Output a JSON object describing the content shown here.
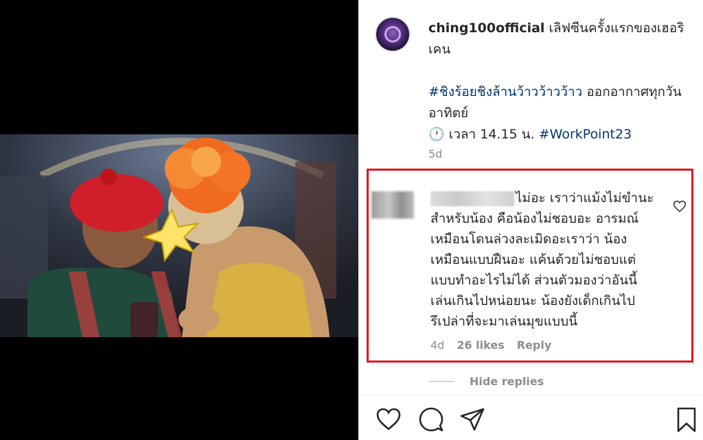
{
  "post": {
    "username": "ching100official",
    "caption_line1": "เลิฟซีนครั้งแรกของเฮอริเคน",
    "hashtag_show": "#ชิงร้อยชิงล้านว้าวว้าวว้าว",
    "caption_line2": "ออกอากาศทุกวันอาทิตย์",
    "time_label": "เวลา 14.15 น.",
    "hashtag_channel": "#WorkPoint23",
    "time_ago": "5d"
  },
  "comment": {
    "lines": [
      "ไม่อะ เราว่าแม้งไม่ขำนะ",
      "สำหรับน้อง คือน้องไม่ชอบอะ อารมณ์",
      "เหมือนโดนล่วงละเมิดอะเราว่า น้อง",
      "เหมือนแบบฝืนอะ แค้นด้วยไม่ชอบแต่",
      "แบบทำอะไรไม่ได้ ส่วนตัวมองว่าอันนี้",
      "เล่นเกินไปหน่อยนะ น้องยังเด็กเกินไป",
      "รึเปล่าที่จะมาเล่นมุขแบบนี้"
    ],
    "age": "4d",
    "likes": "26 likes",
    "reply": "Reply"
  },
  "hide_replies": "Hide replies",
  "icons": {
    "heart": "heart-icon",
    "comment": "comment-icon",
    "share": "share-icon",
    "save": "bookmark-icon",
    "clock": "clock-icon"
  },
  "colors": {
    "highlight_border": "#e0141e",
    "hashtag": "#00376b",
    "muted": "#8e8e8e"
  }
}
